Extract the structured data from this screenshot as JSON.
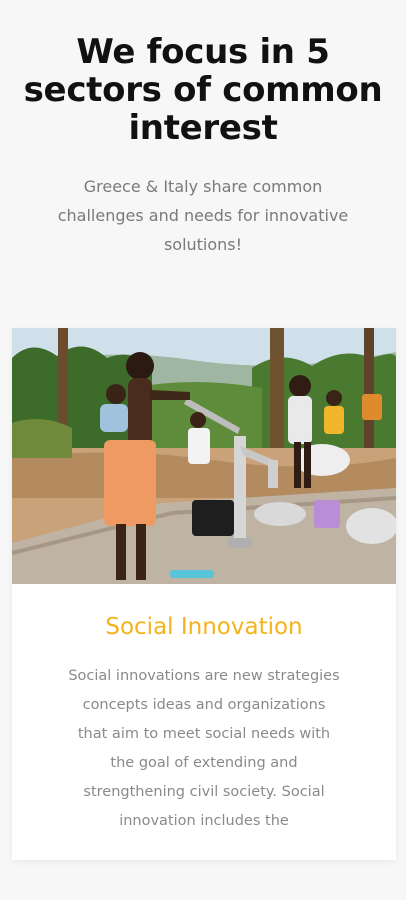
{
  "section": {
    "heading_lines": [
      "We focus in 5",
      "sectors of common",
      "interest"
    ],
    "subheading_lines": [
      "Greece & Italy share common",
      "challenges and needs for innovative",
      "solutions!"
    ]
  },
  "card": {
    "image_icon": "photo-water-pump",
    "title": "Social Innovation",
    "title_color": "#f4b31a",
    "text_lines": [
      "Social innovations are new strategies",
      "concepts ideas and organizations",
      "that aim to meet social needs with",
      "the goal of extending and",
      "strengthening civil society. Social",
      "innovation includes the"
    ]
  }
}
